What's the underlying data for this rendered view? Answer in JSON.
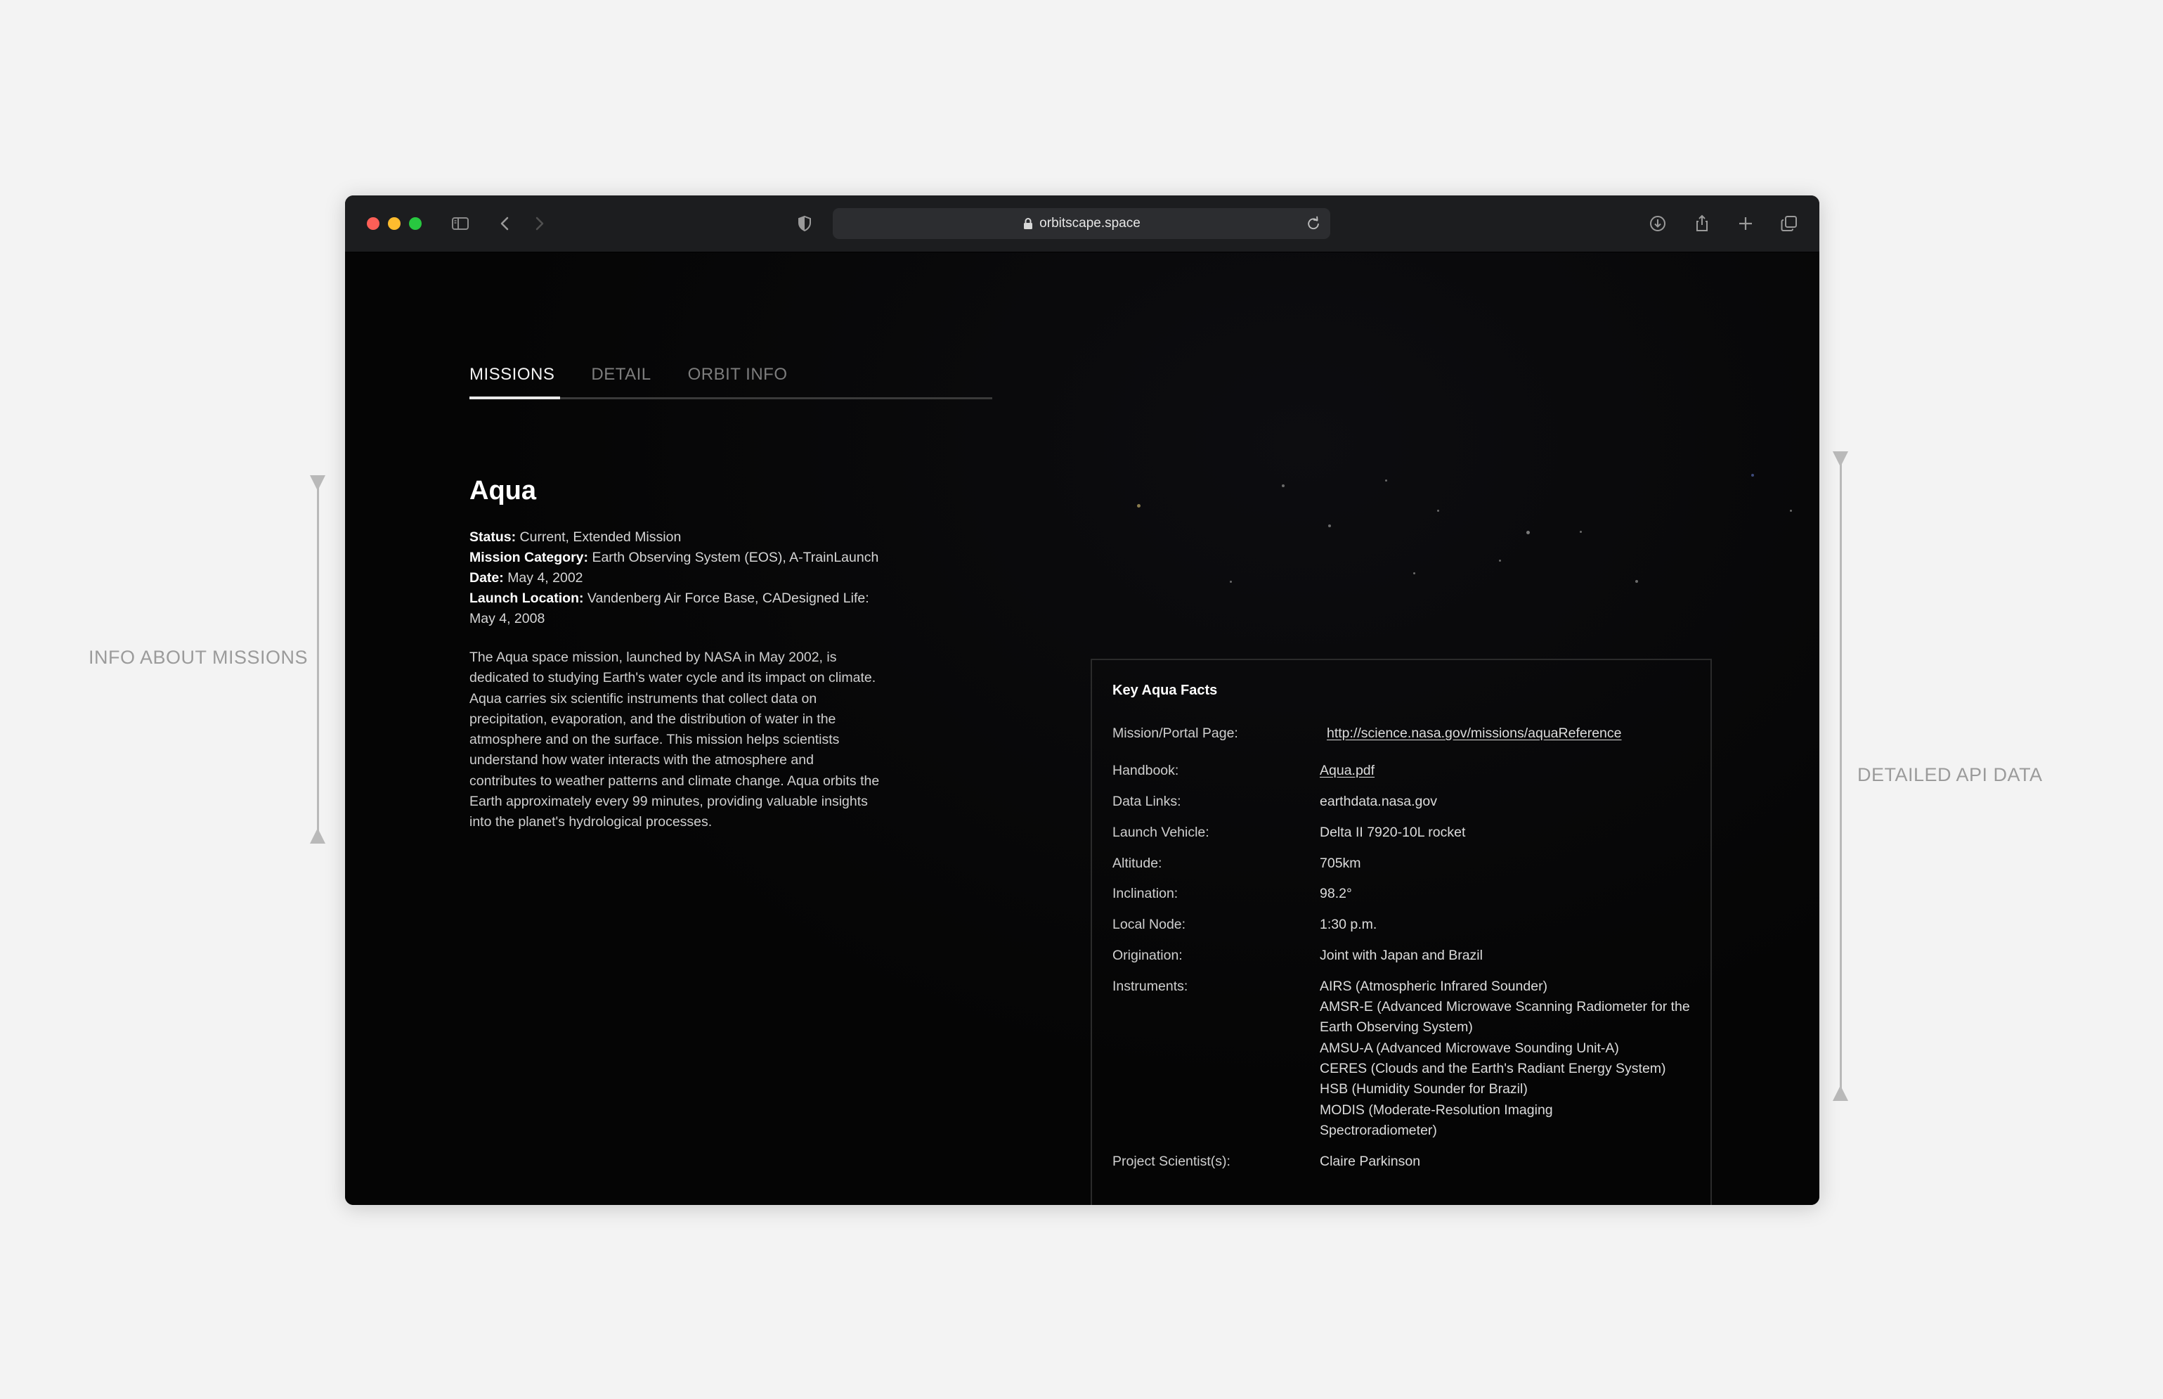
{
  "annotations": {
    "left_label": "INFO ABOUT MISSIONS",
    "right_label": "DETAILED API DATA"
  },
  "browser": {
    "url": "orbitscape.space",
    "icons": [
      "sidebar-icon",
      "back-icon",
      "forward-icon",
      "shield-icon",
      "lock-icon",
      "reload-icon",
      "download-icon",
      "share-icon",
      "new-tab-icon",
      "tabs-overview-icon"
    ]
  },
  "tabs": [
    {
      "label": "MISSIONS",
      "active": true
    },
    {
      "label": "DETAIL",
      "active": false
    },
    {
      "label": "ORBIT INFO",
      "active": false
    }
  ],
  "mission": {
    "name": "Aqua",
    "status_label": "Status:",
    "status_value": "Current, Extended Mission",
    "category_label": "Mission Category:",
    "category_value": "Earth Observing System (EOS), A-TrainLaunch",
    "date_label": "Date:",
    "date_value": "May 4, 2002",
    "location_label": "Launch Location:",
    "location_value": "Vandenberg Air Force Base, CADesigned Life: May 4, 2008",
    "description": "The Aqua space mission, launched by NASA in May 2002, is dedicated to studying Earth's water cycle and its impact on climate. Aqua carries six scientific instruments that collect data on precipitation, evaporation, and the distribution of water in the atmosphere and on the surface. This mission helps scientists understand how water interacts with the atmosphere and contributes to weather patterns and climate change. Aqua orbits the Earth approximately every 99 minutes, providing valuable insights into the planet's hydrological processes."
  },
  "facts": {
    "title": "Key Aqua Facts",
    "rows": [
      {
        "key": "Mission/Portal Page:",
        "value": "http://science.nasa.gov/missions/aquaReference"
      },
      {
        "key": "Handbook:",
        "value": "Aqua.pdf"
      },
      {
        "key": "Data Links:",
        "value": "earthdata.nasa.gov"
      },
      {
        "key": "Launch Vehicle:",
        "value": "Delta II 7920-10L rocket"
      },
      {
        "key": "Altitude:",
        "value": "705km"
      },
      {
        "key": "Inclination:",
        "value": "98.2°"
      },
      {
        "key": "Local Node:",
        "value": "1:30 p.m."
      },
      {
        "key": "Origination:",
        "value": "Joint with Japan and Brazil"
      }
    ],
    "instruments_key": "Instruments:",
    "instruments": [
      "AIRS (Atmospheric Infrared Sounder)",
      "AMSR-E (Advanced Microwave Scanning Radiometer for the Earth Observing System)",
      "AMSU-A (Advanced Microwave Sounding Unit-A)",
      "CERES (Clouds and the Earth's Radiant Energy System)",
      "HSB (Humidity Sounder for Brazil)",
      "MODIS (Moderate-Resolution Imaging Spectroradiometer)"
    ],
    "scientist_key": "Project Scientist(s):",
    "scientist_value": "Claire Parkinson"
  }
}
